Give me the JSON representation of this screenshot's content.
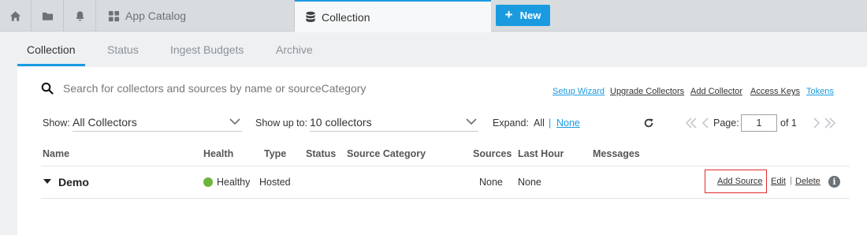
{
  "topbar": {
    "icons": [
      "home-icon",
      "folder-icon",
      "bell-icon"
    ],
    "catalog_tab": {
      "label": "App Catalog",
      "icon": "grid-icon"
    },
    "active_tab": {
      "label": "Collection",
      "icon": "database-icon"
    },
    "new_button": {
      "label": "New",
      "icon": "plus-icon"
    }
  },
  "subtabs": [
    {
      "label": "Collection",
      "active": true
    },
    {
      "label": "Status",
      "active": false
    },
    {
      "label": "Ingest Budgets",
      "active": false
    },
    {
      "label": "Archive",
      "active": false
    }
  ],
  "search": {
    "placeholder": "Search for collectors and sources by name or sourceCategory",
    "value": ""
  },
  "links": {
    "setup_wizard": "Setup Wizard",
    "upgrade_collectors": "Upgrade Collectors",
    "add_collector": "Add Collector",
    "access_keys": "Access Keys",
    "tokens": "Tokens"
  },
  "filters": {
    "show_label": "Show:",
    "show_value": "All Collectors",
    "show_up_to_label": "Show up to:",
    "show_up_to_value": "10 collectors",
    "expand_label": "Expand:",
    "expand_all": "All",
    "expand_sep": "|",
    "expand_none": "None"
  },
  "pager": {
    "page_label": "Page:",
    "page_value": "1",
    "of_text": "of 1"
  },
  "table": {
    "headers": [
      "Name",
      "Health",
      "Type",
      "Status",
      "Source Category",
      "Sources",
      "Last Hour",
      "Messages"
    ],
    "rows": [
      {
        "name": "Demo",
        "health": "Healthy",
        "type": "Hosted",
        "status": "",
        "source_category": "",
        "sources": "None",
        "last_hour": "None",
        "messages": "",
        "actions": {
          "add_source": "Add Source",
          "edit": "Edit",
          "separator": "|",
          "delete": "Delete"
        }
      }
    ]
  },
  "colors": {
    "accent": "#1a9be0",
    "healthy": "#6db43a",
    "highlight": "#e0282a"
  }
}
